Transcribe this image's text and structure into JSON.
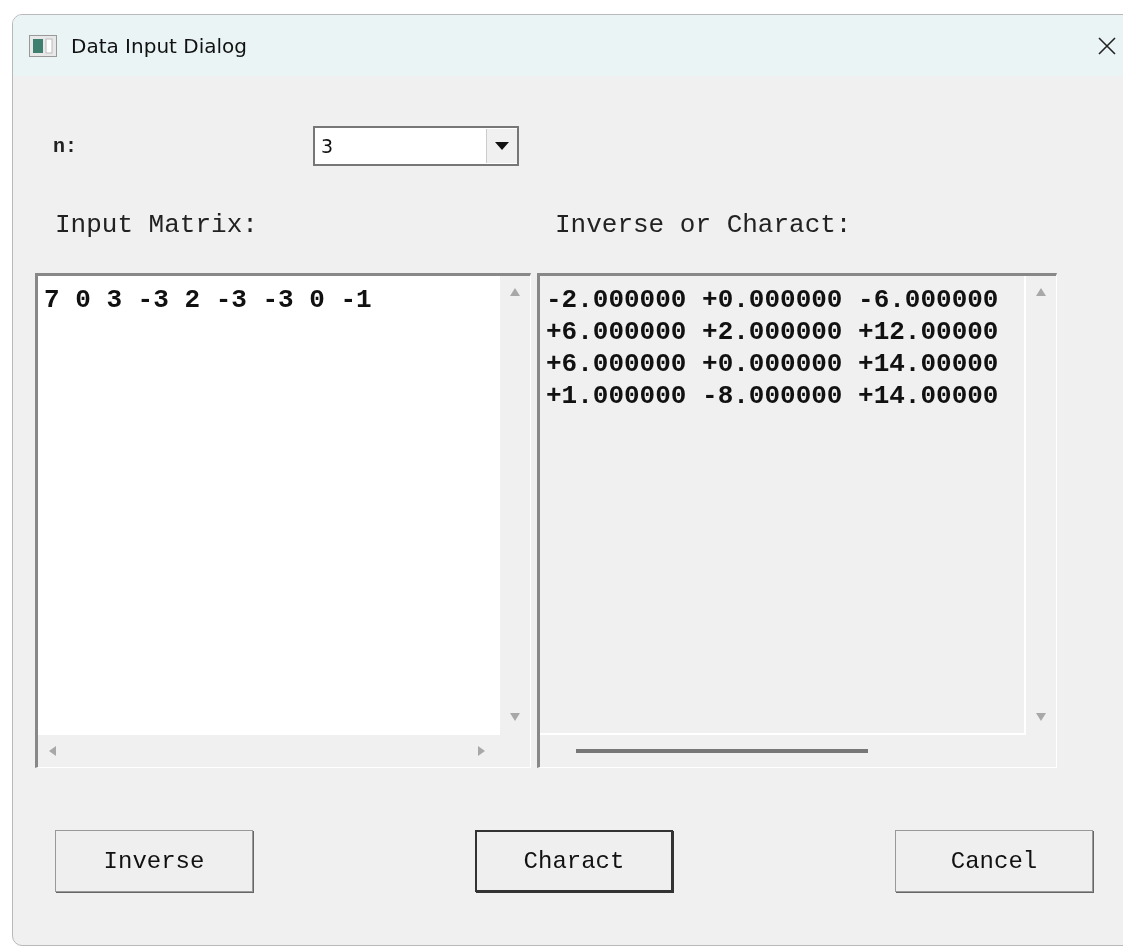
{
  "window": {
    "title": "Data Input Dialog"
  },
  "n_field": {
    "label": "n:",
    "value": "3"
  },
  "input_matrix": {
    "label": "Input Matrix:",
    "lines": [
      "7 0 3 -3 2 -3 -3 0 -1"
    ]
  },
  "result": {
    "label": "Inverse or Charact:",
    "lines": [
      "-2.000000 +0.000000 -6.000000",
      "+6.000000 +2.000000 +12.00000",
      "+6.000000 +0.000000 +14.00000",
      "+1.000000 -8.000000 +14.00000"
    ]
  },
  "buttons": [
    {
      "label": "Inverse",
      "default": false
    },
    {
      "label": "Charact",
      "default": true
    },
    {
      "label": "Cancel",
      "default": false
    }
  ]
}
